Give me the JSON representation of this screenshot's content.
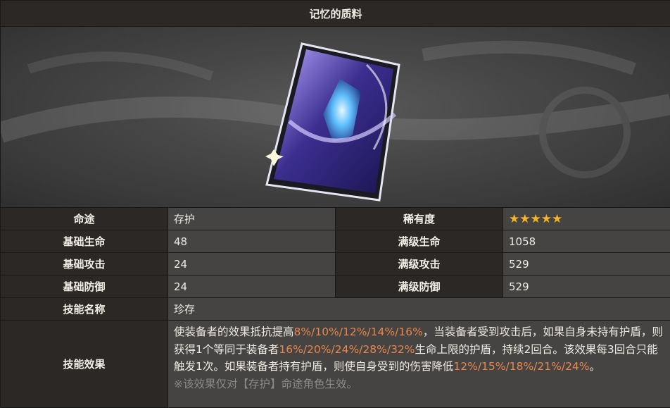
{
  "title": "记忆的质料",
  "rows": [
    {
      "h1": "命途",
      "v1": "存护",
      "h2": "稀有度",
      "stars": "★★★★★"
    },
    {
      "h1": "基础生命",
      "v1": "48",
      "h2": "满级生命",
      "v2": "1058"
    },
    {
      "h1": "基础攻击",
      "v1": "24",
      "h2": "满级攻击",
      "v2": "529"
    },
    {
      "h1": "基础防御",
      "v1": "24",
      "h2": "满级防御",
      "v2": "529"
    }
  ],
  "skill_name_label": "技能名称",
  "skill_name": "珍存",
  "skill_effect_label": "技能效果",
  "effect": {
    "p1": "使装备者的效果抵抗提高",
    "hl1": "8%/10%/12%/14%/16%",
    "p2": "，当装备者受到攻击后，如果自身未持有护盾，则获得1个等同于装备者",
    "hl2": "16%/20%/24%/28%/32%",
    "p3": "生命上限的护盾，持续2回合。该效果每3回合只能触发1次。如果装备者持有护盾，则使自身受到的伤害降低",
    "hl3": "12%/15%/18%/21%/24%",
    "p4": "。",
    "note": "※该效果仅对【存护】命途角色生效。"
  },
  "colors": {
    "accent": "#e8854a",
    "star": "#f5b52a",
    "header_bg": "#2b2825",
    "value_bg": "#454442"
  }
}
